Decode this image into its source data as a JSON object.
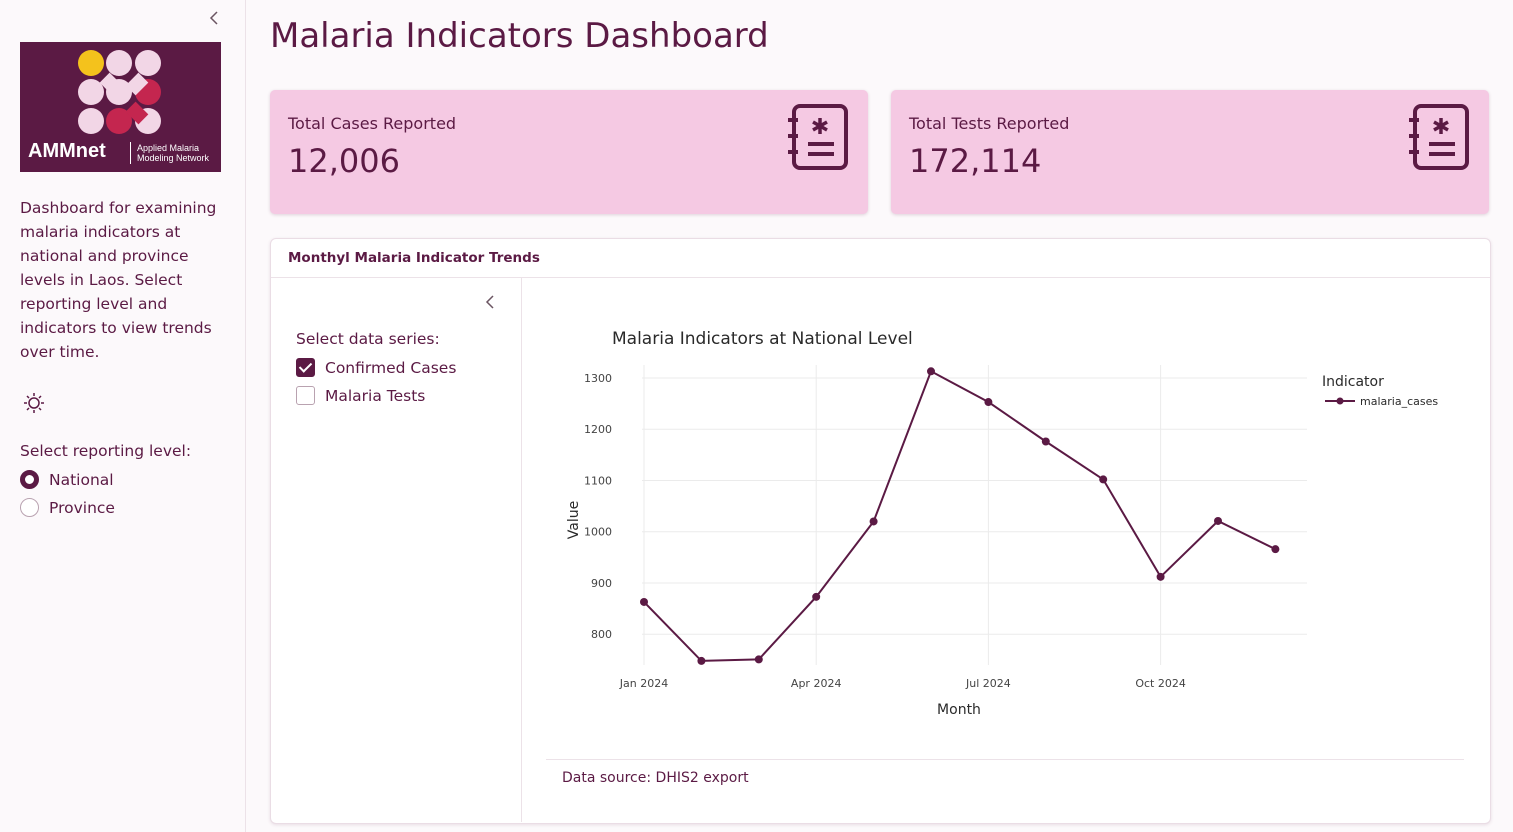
{
  "sidebar": {
    "logo_text": "AMMnet",
    "logo_subtitle_1": "Applied Malaria",
    "logo_subtitle_2": "Modeling Network",
    "description": "Dashboard for examining malaria indicators at national and province levels in Laos. Select reporting level and indicators to view trends over time.",
    "reporting_label": "Select reporting level:",
    "reporting_options": [
      {
        "label": "National",
        "selected": true
      },
      {
        "label": "Province",
        "selected": false
      }
    ]
  },
  "main": {
    "title": "Malaria Indicators Dashboard",
    "kpis": [
      {
        "label": "Total Cases Reported",
        "value": "12,006"
      },
      {
        "label": "Total Tests Reported",
        "value": "172,114"
      }
    ],
    "card": {
      "header": "Monthyl Malaria Indicator Trends",
      "series_label": "Select data series:",
      "series_options": [
        {
          "label": "Confirmed Cases",
          "checked": true
        },
        {
          "label": "Malaria Tests",
          "checked": false
        }
      ],
      "footer": "Data source: DHIS2 export"
    }
  },
  "colors": {
    "primary": "#5b1a44",
    "kpi_bg": "#f5c9e3",
    "page_bg": "#fcf9fb"
  },
  "chart_data": {
    "type": "line",
    "title": "Malaria Indicators at National Level",
    "xlabel": "Month",
    "ylabel": "Value",
    "legend_title": "Indicator",
    "legend_position": "top-right",
    "grid": true,
    "x": [
      "2024-01",
      "2024-02",
      "2024-03",
      "2024-04",
      "2024-05",
      "2024-06",
      "2024-07",
      "2024-08",
      "2024-09",
      "2024-10",
      "2024-11",
      "2024-12"
    ],
    "x_ticks": [
      "Jan 2024",
      "Apr 2024",
      "Jul 2024",
      "Oct 2024"
    ],
    "y_ticks": [
      800,
      900,
      1000,
      1100,
      1200,
      1300
    ],
    "series": [
      {
        "name": "malaria_cases",
        "values": [
          863,
          748,
          751,
          873,
          1020,
          1313,
          1253,
          1176,
          1102,
          912,
          1021,
          966
        ]
      }
    ]
  }
}
